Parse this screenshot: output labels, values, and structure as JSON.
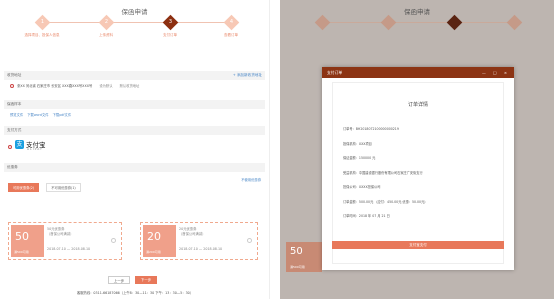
{
  "left": {
    "title": "保函申请",
    "steps": [
      {
        "num": "1",
        "label": "选择项目、投保人信息",
        "active": false
      },
      {
        "num": "2",
        "label": "上传资料",
        "active": false
      },
      {
        "num": "3",
        "label": "支付订单",
        "active": true
      },
      {
        "num": "4",
        "label": "查看订单",
        "active": false
      }
    ],
    "address_section": "收货地址",
    "address_add": "+ 添加新收货地址",
    "address_line": "张XX  河北省 石家庄市 长安区 XXX路XXX号XXX号",
    "address_default": "设为默认",
    "address_edit": "默认收货地址",
    "template_section": "保函样本",
    "template_links": [
      "预览文件",
      "下载word文件",
      "下载pdf文件"
    ],
    "payment_section": "支付方式",
    "alipay_label": "支付宝",
    "alipay_sub": "ALIPAY",
    "coupon_section": "优惠券",
    "coupon_tabs": [
      "可用优惠券(2)",
      "不可用优惠券(1)"
    ],
    "coupon_rule": "不使用优惠券",
    "coupons": [
      {
        "amount": "50",
        "tag": "满500可用",
        "name": "50元优惠券",
        "scope": "（首保公司满减）",
        "date": "2018.07.10 — 2018.08.10"
      },
      {
        "amount": "20",
        "tag": "满200可用",
        "name": "20元优惠券",
        "scope": "（首保公司满减）",
        "date": "2018.07.10 — 2018.08.10"
      }
    ],
    "prev_btn": "上一步",
    "next_btn": "下一步",
    "footer": "客服热线：0311-66187066（上午8：30—11：30 下午：13：30—5：30）"
  },
  "right": {
    "title": "保函申请",
    "modal_title": "支付订单",
    "modal_ctl": "— □ ×",
    "order_title": "订单详情",
    "fields": [
      "订单号：BH2018072100000000219",
      "投保机构：XXX项目",
      "保证金额：150000 元",
      "受益机构：中国建设银行股份有限公司石家庄广安街支行",
      "担保公司：XXXX担保公司",
      "订单金额：500.00元  （应付：450.00元  优惠：50.00元）",
      "订单时间：2018 年 07 月 21 日"
    ],
    "pay_btn": "支付宝支付",
    "bg_coupon": "50",
    "bg_coupon_tag": "满500可用"
  },
  "colors": {
    "accent": "#e8785a",
    "active_step": "#8c2f10",
    "modal_header": "#8c3414"
  }
}
